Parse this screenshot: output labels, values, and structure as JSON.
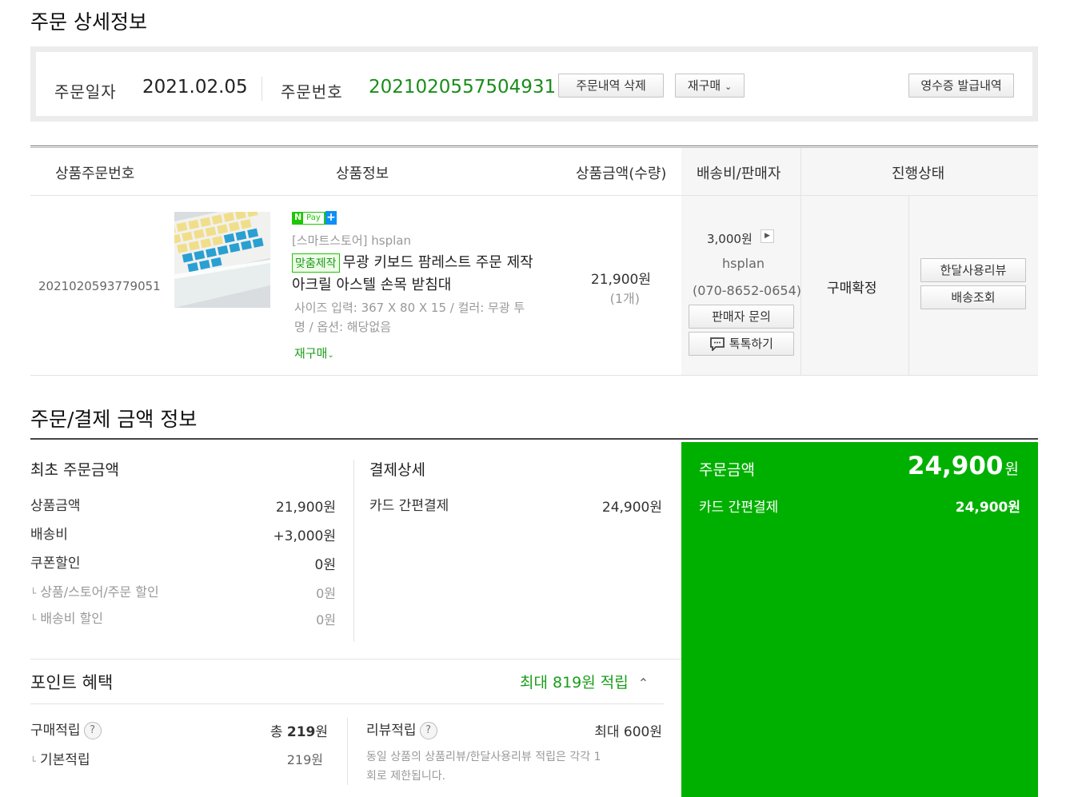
{
  "page_title": "주문 상세정보",
  "order": {
    "date_label": "주문일자",
    "date": "2021.02.05",
    "number_label": "주문번호",
    "number": "2021020557504931",
    "delete_button": "주문내역 삭제",
    "reorder_button": "재구매",
    "receipt_button": "영수증 발급내역"
  },
  "table": {
    "headers": [
      "상품주문번호",
      "상품정보",
      "상품금액(수량)",
      "배송비/판매자",
      "진행상태"
    ],
    "item": {
      "product_order_no": "2021020593779051",
      "npay_label": "Pay",
      "store": "[스마트스토어] hsplan",
      "custom_tag": "맞춤제작",
      "name_line1": "무광 키보드 팜레스트 주문 제작",
      "name_line2": "아크릴 아스텔 손목 받침대",
      "options_line1": "사이즈 입력: 367 X 80 X 15 / 컬러: 무광 투",
      "options_line2": "명 / 옵션: 해당없음",
      "reorder_link": "재구매",
      "price": "21,900원",
      "quantity": "(1개)",
      "shipping_fee": "3,000원",
      "seller": "hsplan",
      "seller_phone": "(070-8652-0654)",
      "seller_inquiry_button": "판매자 문의",
      "talk_button": "톡톡하기",
      "status": "구매확정",
      "review_button": "한달사용리뷰",
      "tracking_button": "배송조회"
    }
  },
  "payment": {
    "section_title": "주문/결제 금액 정보",
    "initial_title": "최초 주문금액",
    "rows": [
      {
        "label": "상품금액",
        "value": "21,900원"
      },
      {
        "label": "배송비",
        "value": "+3,000원"
      },
      {
        "label": "쿠폰할인",
        "value": "0원"
      }
    ],
    "sub_rows": [
      {
        "label": "상품/스토어/주문 할인",
        "value": "0원"
      },
      {
        "label": "배송비 할인",
        "value": "0원"
      }
    ],
    "detail_title": "결제상세",
    "detail_label": "카드 간편결제",
    "detail_value": "24,900원",
    "total_label": "주문금액",
    "total_value": "24,900",
    "total_unit": "원",
    "total_method_label": "카드 간편결제",
    "total_method_value": "24,900원"
  },
  "points": {
    "title": "포인트 혜택",
    "max_summary": "최대 819원 적립",
    "purchase_label": "구매적립",
    "purchase_prefix": "총",
    "purchase_value": "219",
    "purchase_unit": "원",
    "basic_label": "기본적립",
    "basic_value": "219원",
    "review_label": "리뷰적립",
    "review_value": "최대 600원",
    "review_note_line1": "동일 상품의 상품리뷰/한달사용리뷰 적립은 각각 1",
    "review_note_line2": "회로 제한됩니다.",
    "help_symbol": "?"
  },
  "colors": {
    "accent_green": "#00b000",
    "order_number_green": "#1a8d1a"
  }
}
